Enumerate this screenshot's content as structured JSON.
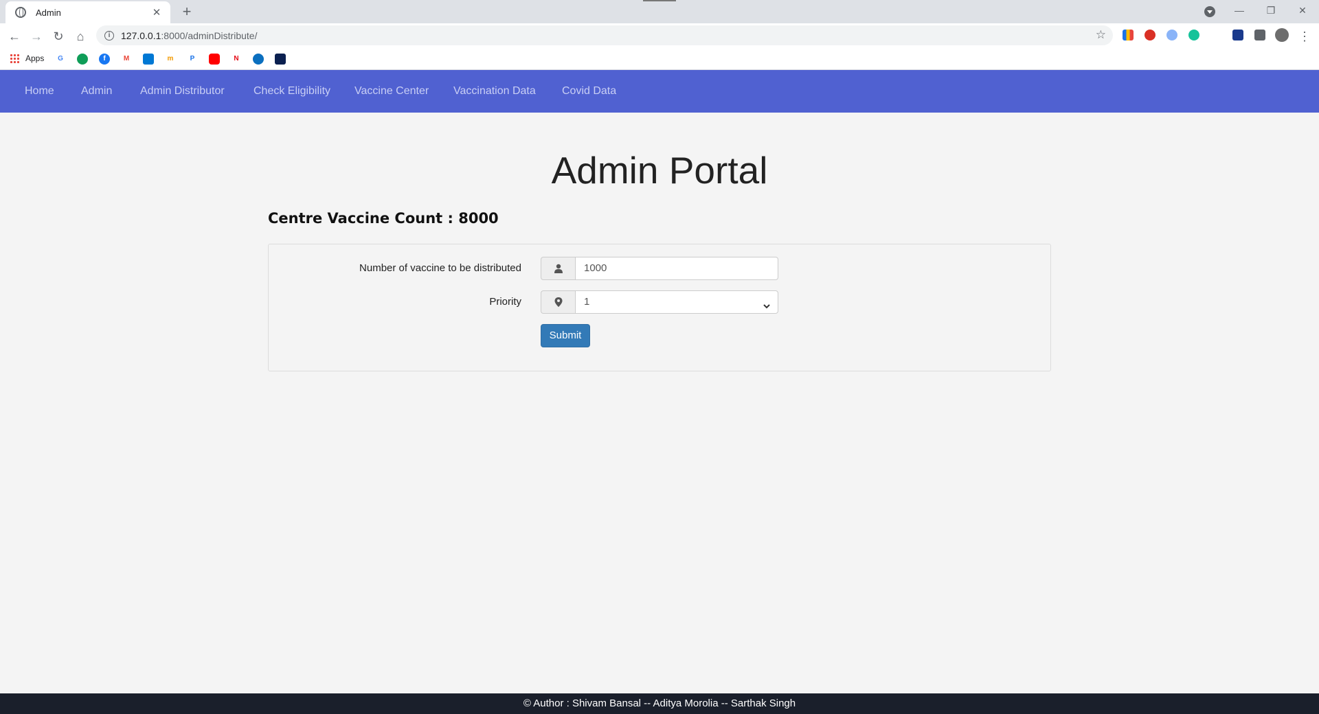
{
  "browser": {
    "tab_title": "Admin",
    "tab_close": "✕",
    "new_tab": "+",
    "url_host": "127.0.0.1",
    "url_path": ":8000/adminDistribute/",
    "back": "←",
    "forward": "→",
    "reload": "↻",
    "home": "⌂",
    "star": "☆",
    "menu": "⋮",
    "minimize": "—",
    "restore": "❐",
    "close": "✕",
    "bookmarks_apps_label": "Apps"
  },
  "navbar": {
    "items": [
      {
        "label": "Home"
      },
      {
        "label": "Admin"
      },
      {
        "label": "Admin Distributor"
      },
      {
        "label": "Check Eligibility"
      },
      {
        "label": "Vaccine Center"
      },
      {
        "label": "Vaccination Data"
      },
      {
        "label": "Covid Data"
      }
    ],
    "bg_color": "#5061d1"
  },
  "main": {
    "title": "Admin Portal",
    "count_text": "Centre Vaccine Count : 8000"
  },
  "form": {
    "quantity_label": "Number of vaccine to be distributed",
    "quantity_value": "1000",
    "priority_label": "Priority",
    "priority_value": "1",
    "submit_label": "Submit",
    "quantity_icon": "user-icon",
    "priority_icon": "map-marker-icon"
  },
  "footer": {
    "text": "© Author : Shivam Bansal -- Aditya Morolia -- Sarthak Singh"
  }
}
